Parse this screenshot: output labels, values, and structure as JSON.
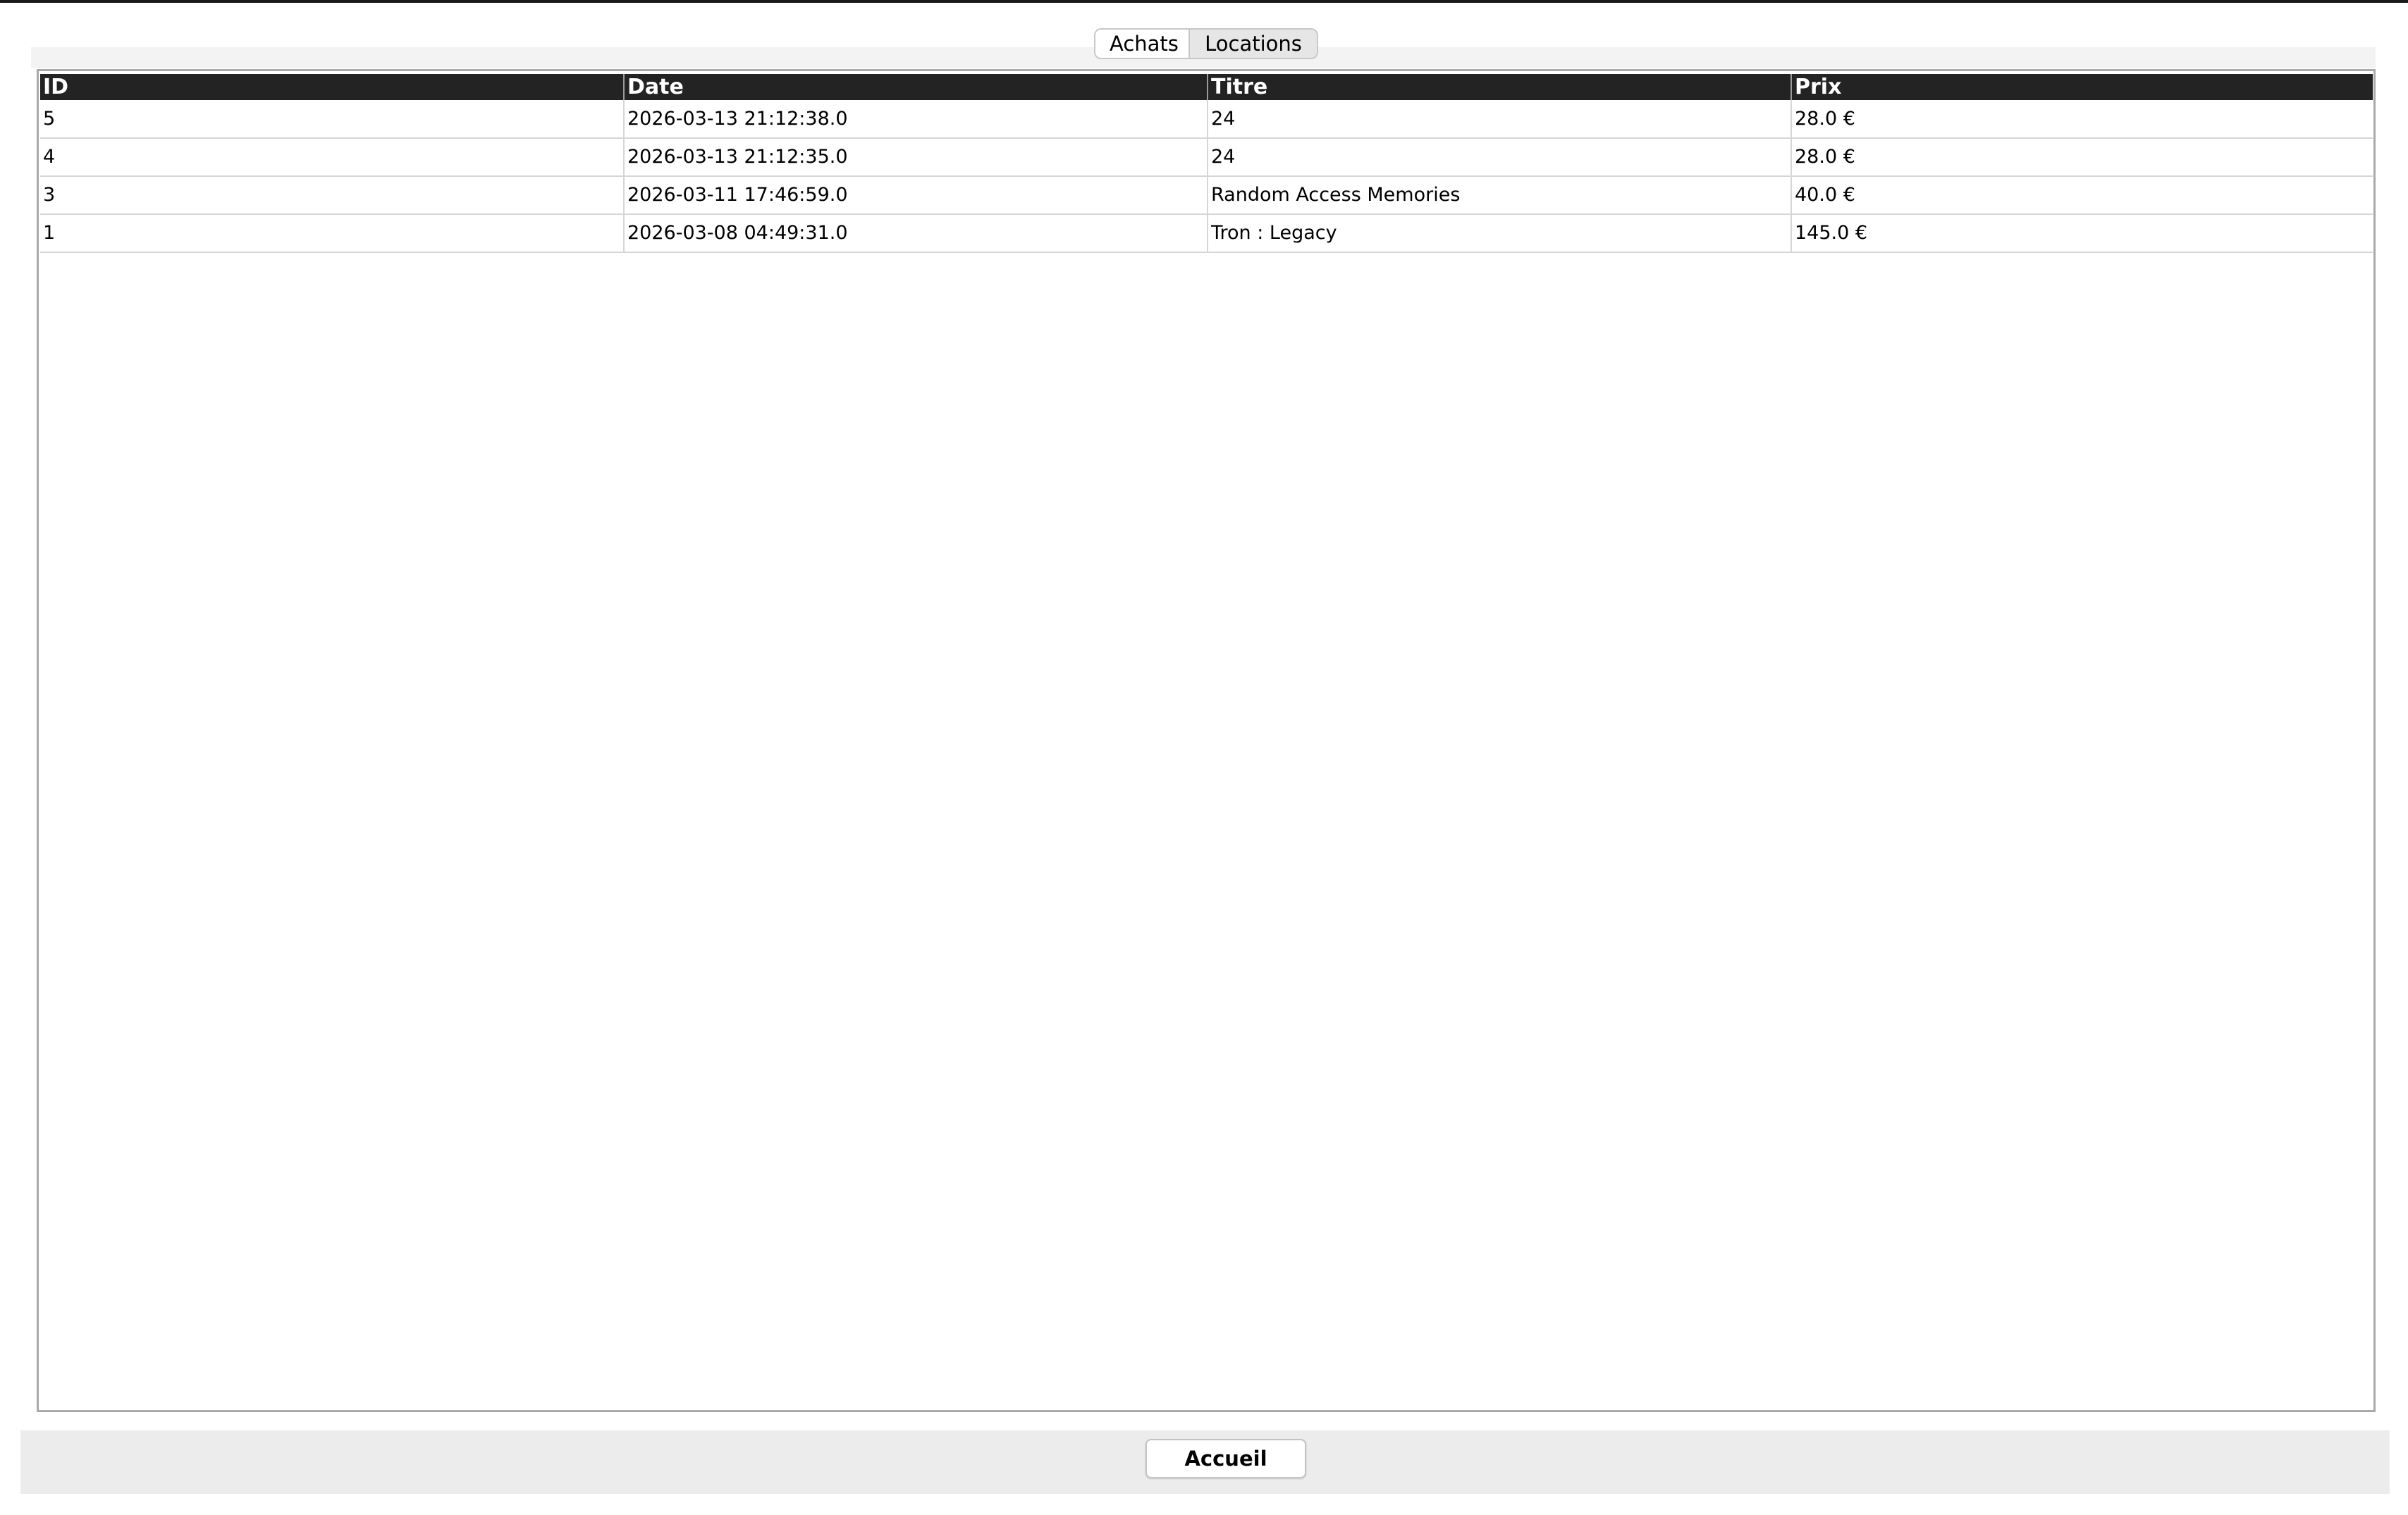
{
  "tabs": [
    {
      "label": "Achats",
      "selected": true
    },
    {
      "label": "Locations",
      "selected": false
    }
  ],
  "table": {
    "columns": [
      "ID",
      "Date",
      "Titre",
      "Prix"
    ],
    "rows": [
      {
        "id": "5",
        "date": "2026-03-13 21:12:38.0",
        "titre": "24",
        "prix": "28.0 €"
      },
      {
        "id": "4",
        "date": "2026-03-13 21:12:35.0",
        "titre": "24",
        "prix": "28.0 €"
      },
      {
        "id": "3",
        "date": "2026-03-11 17:46:59.0",
        "titre": "Random Access Memories",
        "prix": "40.0 €"
      },
      {
        "id": "1",
        "date": "2026-03-08 04:49:31.0",
        "titre": "Tron : Legacy",
        "prix": "145.0 €"
      }
    ]
  },
  "footer": {
    "home_label": "Accueil"
  },
  "colors": {
    "header_bg": "#232323",
    "header_text": "#ffffff",
    "footer_bg": "#ececec"
  }
}
